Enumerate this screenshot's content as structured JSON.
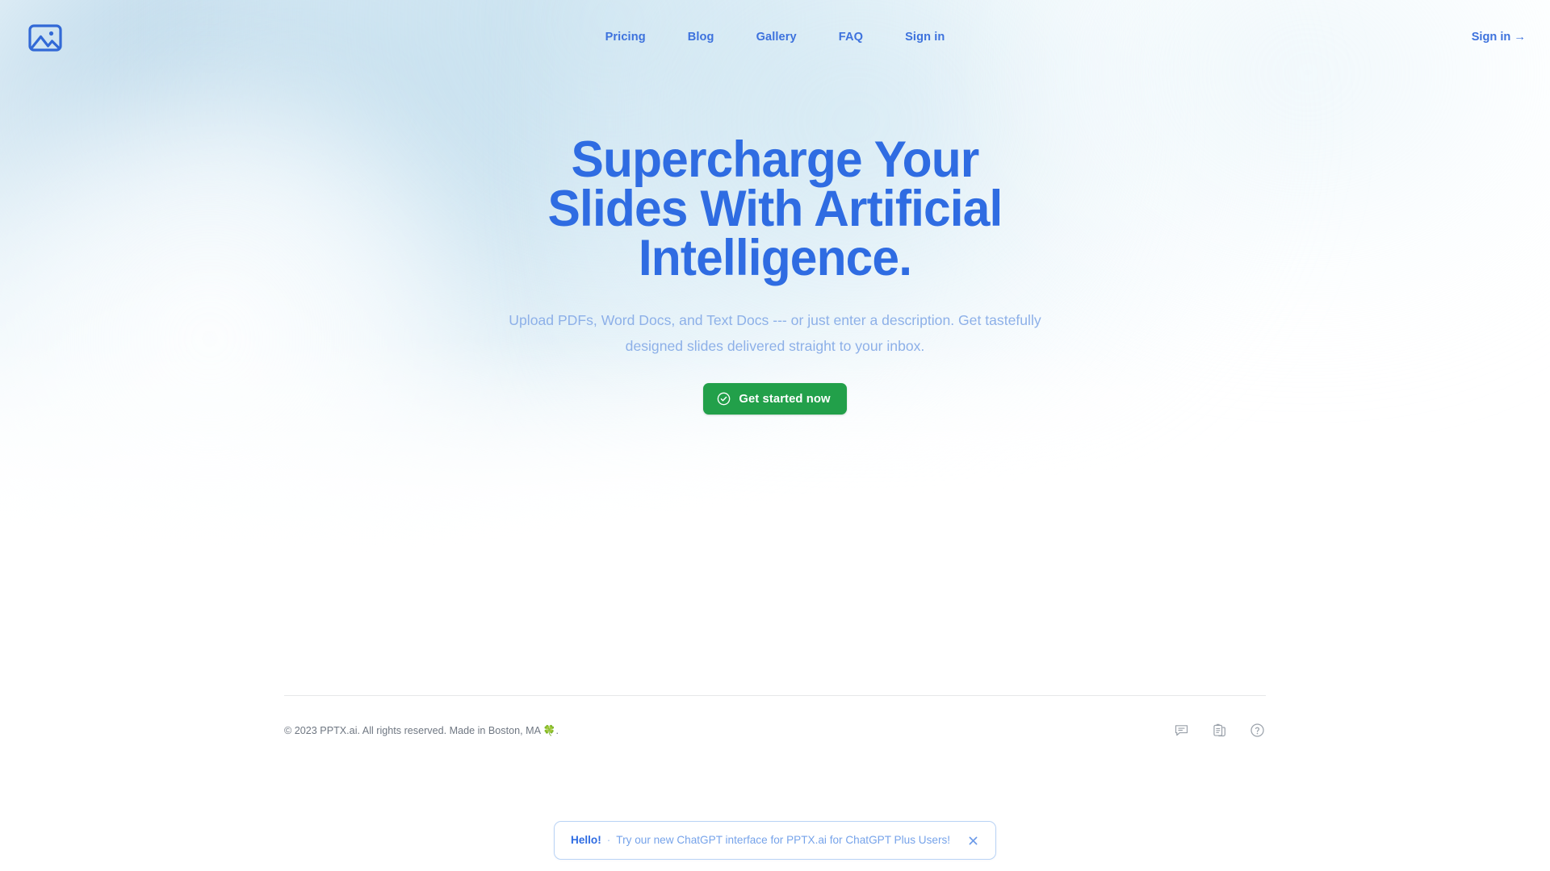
{
  "header": {
    "logo_icon": "image-photo-icon",
    "nav_items": [
      {
        "label": "Pricing"
      },
      {
        "label": "Blog"
      },
      {
        "label": "Gallery"
      },
      {
        "label": "FAQ"
      },
      {
        "label": "Sign in"
      }
    ],
    "signin_right_label": "Sign in →"
  },
  "hero": {
    "title": "Supercharge Your Slides With Artificial Intelligence.",
    "subtitle": "Upload PDFs, Word Docs, and Text Docs --- or just enter a description. Get tastefully designed slides delivered straight to your inbox.",
    "cta_label": "Get started now",
    "cta_icon": "check-circle-icon"
  },
  "footer": {
    "copyright_before": "© 2023 PPTX.ai. All rights reserved. Made in Boston, MA ",
    "clover": "🍀",
    "copyright_after": ".",
    "icons": [
      {
        "name": "chat-bubble-icon"
      },
      {
        "name": "clipboard-copy-icon"
      },
      {
        "name": "question-mark-circle-icon"
      }
    ]
  },
  "banner": {
    "greeting": "Hello!",
    "separator": "·",
    "message": "Try our new ChatGPT interface for PPTX.ai for ChatGPT Plus Users!",
    "close_icon": "close-x-icon"
  },
  "colors": {
    "brand_blue": "#2f6ce2",
    "nav_blue": "#3d72dd",
    "subtitle_blue": "#8db0e8",
    "cta_green": "#22a04a",
    "banner_border": "#b9d3f5",
    "footer_text": "#6f7782",
    "divider": "#e6e7e9"
  }
}
